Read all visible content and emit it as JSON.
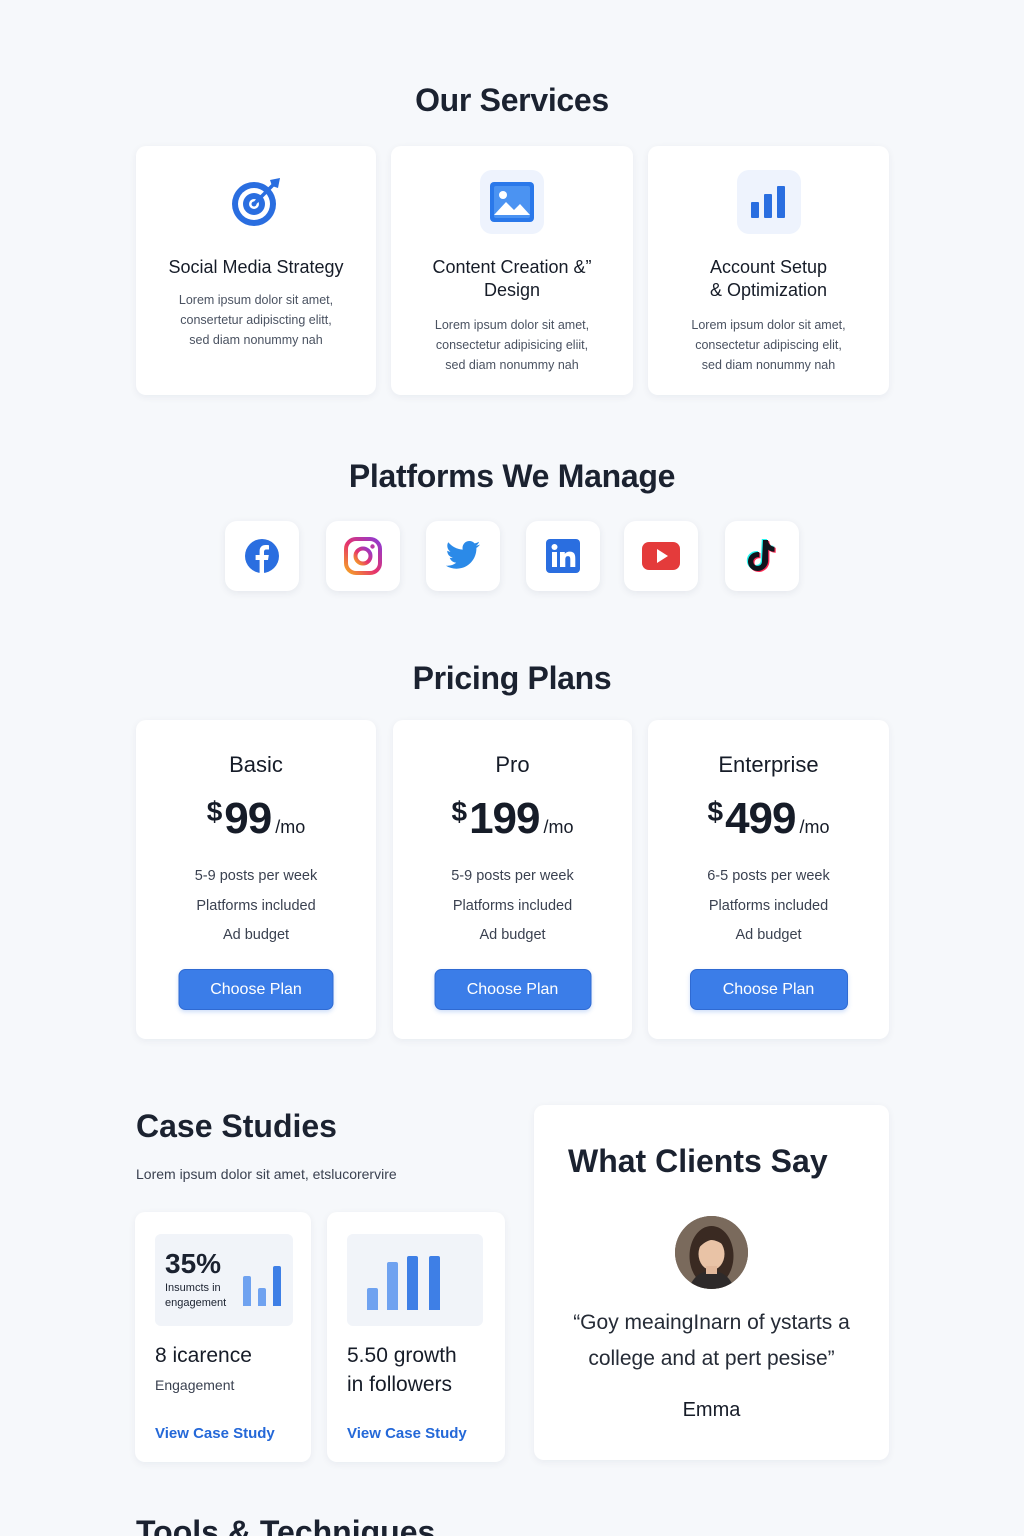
{
  "services": {
    "title": "Our Services",
    "items": [
      {
        "title": "Social Media Strategy",
        "icon": "target-icon",
        "desc": [
          "Lorem ipsum dolor sit amet,",
          "consertetur adipiscting elitt,",
          "sed diam nonummy nah"
        ]
      },
      {
        "title": "Content Creation &”",
        "title2": "Design",
        "icon": "image-icon",
        "desc": [
          "Lorem ipsum dolor sit amet,",
          "consectetur adipisicing eliit,",
          "sed diam nonummy nah"
        ]
      },
      {
        "title": "Account Setup",
        "title2": "& Optimization",
        "icon": "bar-chart-icon",
        "desc": [
          "Lorem ipsum dolor sit amet,",
          "consectetur adipiscing elit,",
          "sed diam nonummy nah"
        ]
      }
    ]
  },
  "platforms": {
    "title": "Platforms We Manage",
    "items": [
      "facebook-icon",
      "instagram-icon",
      "twitter-icon",
      "linkedin-icon",
      "youtube-icon",
      "tiktok-icon"
    ]
  },
  "pricing": {
    "title": "Pricing Plans",
    "plans": [
      {
        "name": "Basic",
        "currency": "$",
        "amount": "99",
        "period": "/mo",
        "features": [
          "5-9 posts per week",
          "Platforms included",
          "Ad budget"
        ],
        "cta": "Choose Plan"
      },
      {
        "name": "Pro",
        "currency": "$",
        "amount": "199",
        "period": "/mo",
        "features": [
          "5-9 posts per week",
          "Platforms included",
          "Ad budget"
        ],
        "cta": "Choose Plan"
      },
      {
        "name": "Enterprise",
        "currency": "$",
        "amount": "499",
        "period": "/mo",
        "features": [
          "6-5 posts per week",
          "Platforms included",
          "Ad budget"
        ],
        "cta": "Choose Plan"
      }
    ]
  },
  "case_studies": {
    "title": "Case Studies",
    "subtitle": "Lorem ipsum dolor sit amet, etslucorervire",
    "items": [
      {
        "stat": "35%",
        "stat_label_1": "Insumcts in",
        "stat_label_2": "engagement",
        "headline": "8 icarence",
        "sub": "Engagement",
        "link": "View Case Study"
      },
      {
        "headline_1": "5.50 growth",
        "headline_2": "in followers",
        "link": "View Case Study"
      }
    ]
  },
  "testimonial": {
    "title": "What Clients Say",
    "quote_1": "“Goy meaingInarn of ystarts a",
    "quote_2": "college and at pert pesise”",
    "name": "Emma"
  },
  "tools": {
    "title": "Tools & Techniques"
  },
  "colors": {
    "accent": "#3b7de8",
    "link": "#2468d8",
    "background": "#f6f8fb",
    "heading": "#1b2230"
  }
}
